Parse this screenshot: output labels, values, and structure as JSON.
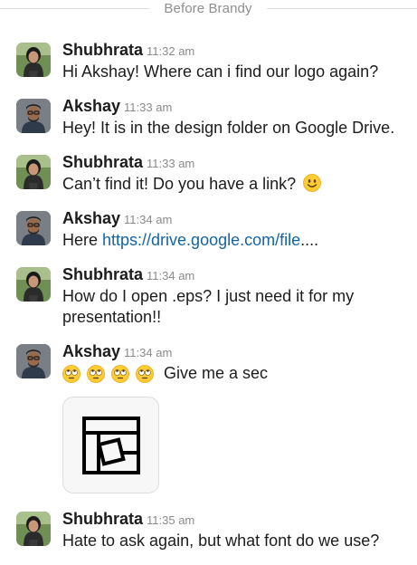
{
  "divider": {
    "label": "Before Brandy"
  },
  "colors": {
    "link": "#1264a3",
    "text": "#1d1c1d",
    "timestamp": "#8a8a8a",
    "divider_text": "#8f8f8f"
  },
  "messages": [
    {
      "sender": "Shubhrata",
      "time": "11:32 am",
      "text": "Hi Akshay! Where can i find our logo again?",
      "avatar": "shubhrata-avatar"
    },
    {
      "sender": "Akshay",
      "time": "11:33 am",
      "text": "Hey! It is in the design folder on Google Drive.",
      "avatar": "akshay-avatar"
    },
    {
      "sender": "Shubhrata",
      "time": "11:33 am",
      "text": "Can’t find it! Do you have a link?",
      "emoji": "slightly-smiling-face",
      "avatar": "shubhrata-avatar"
    },
    {
      "sender": "Akshay",
      "time": "11:34 am",
      "text_prefix": "Here ",
      "link": "https://drive.google.com/file",
      "text_suffix": "....",
      "avatar": "akshay-avatar"
    },
    {
      "sender": "Shubhrata",
      "time": "11:34 am",
      "text": "How do I open .eps? I just need it for my presentation!!",
      "avatar": "shubhrata-avatar"
    },
    {
      "sender": "Akshay",
      "time": "11:34 am",
      "emojis": [
        "face-with-rolling-eyes",
        "face-with-rolling-eyes",
        "face-with-rolling-eyes",
        "face-with-rolling-eyes"
      ],
      "text": "Give me a sec",
      "attachment": "logo-file-thumbnail",
      "avatar": "akshay-avatar"
    },
    {
      "sender": "Shubhrata",
      "time": "11:35 am",
      "text": "Hate to ask again, but what font do we use?",
      "avatar": "shubhrata-avatar"
    }
  ]
}
